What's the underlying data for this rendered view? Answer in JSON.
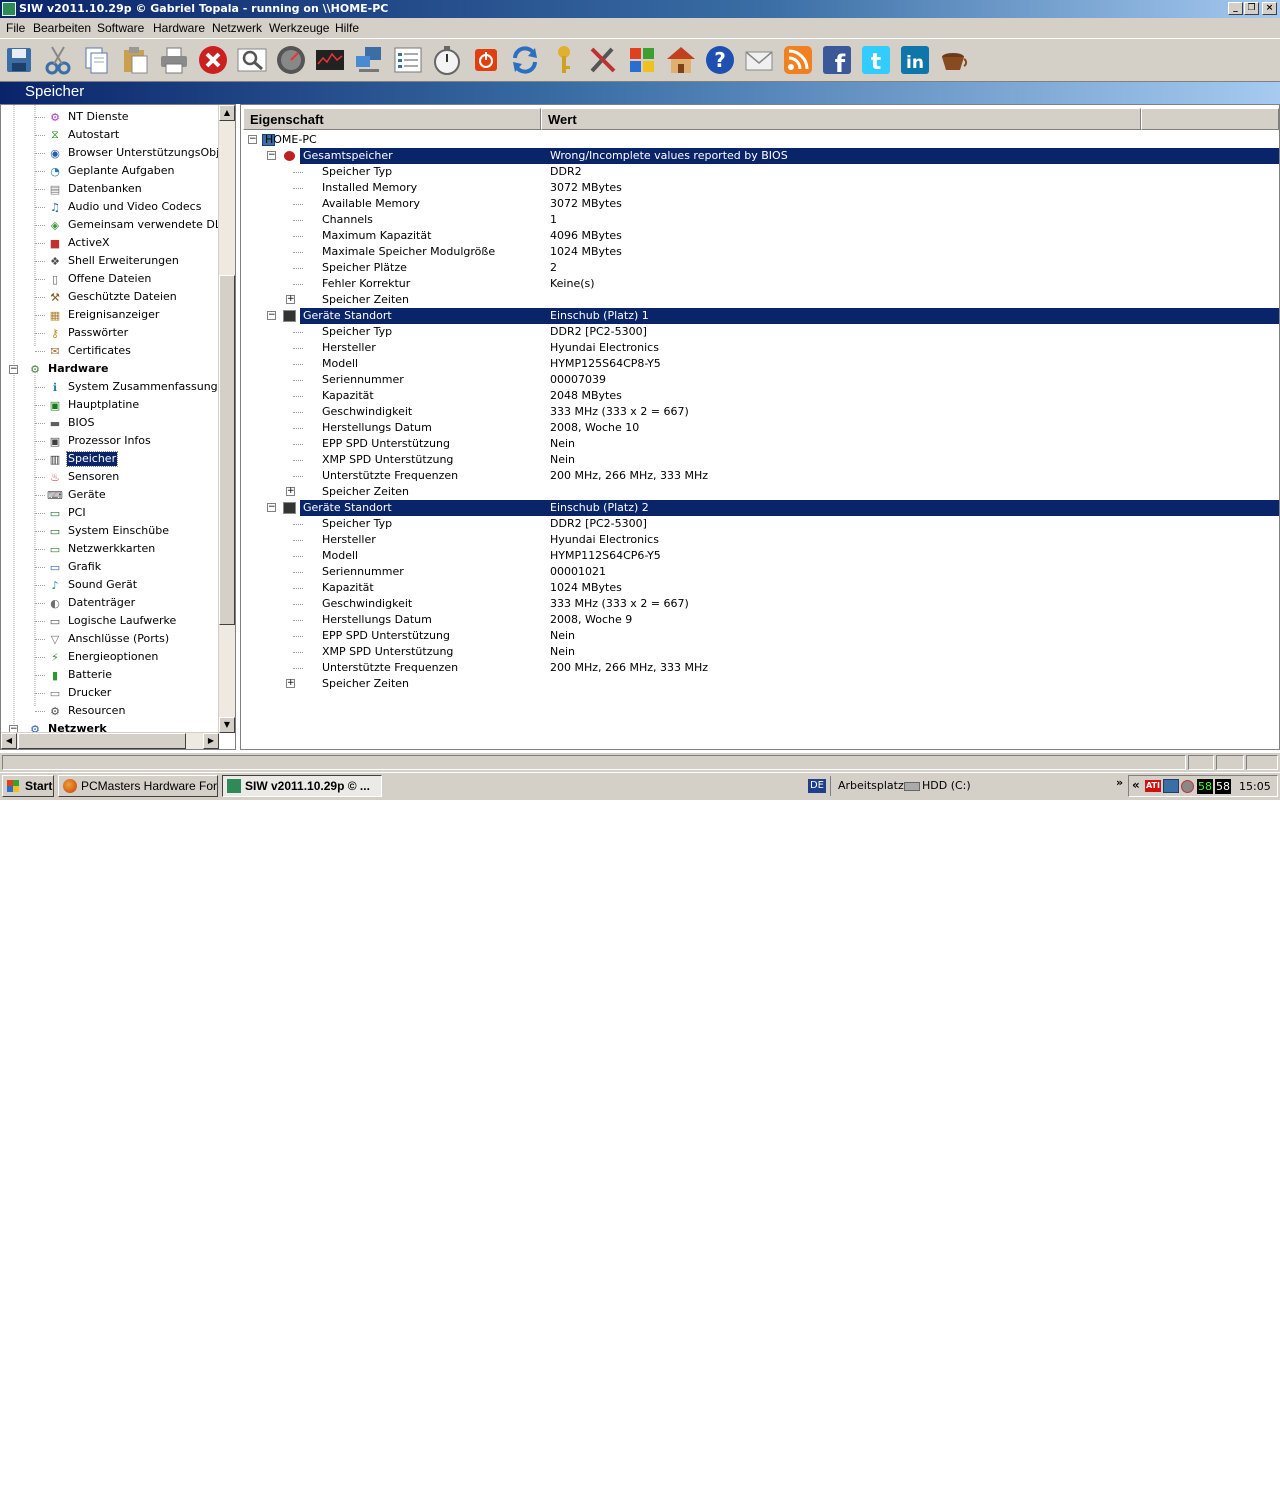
{
  "window": {
    "title": "SIW v2011.10.29p  © Gabriel Topala - running on \\\\HOME-PC",
    "min": "_",
    "max": "❐",
    "close": "×"
  },
  "menu": [
    "File",
    "Bearbeiten",
    "Software",
    "Hardware",
    "Netzwerk",
    "Werkzeuge",
    "Hilfe"
  ],
  "toolbar_icons": [
    "save-icon",
    "cut-icon",
    "copy-icon",
    "paste-icon",
    "print-icon",
    "stop-icon",
    "search-icon",
    "speed-gauge-icon",
    "monitor-icon",
    "network-computer-icon",
    "list-icon",
    "stopwatch-icon",
    "shutdown-icon",
    "refresh-icon",
    "key-icon",
    "tools-icon",
    "windows-icon",
    "home-icon",
    "help-icon",
    "mail-icon",
    "rss-icon",
    "facebook-icon",
    "twitter-icon",
    "linkedin-icon",
    "coffee-icon"
  ],
  "section_title": "Speicher",
  "tree": [
    {
      "label": "NT Dienste",
      "icon": "services-icon",
      "glyph": "⚙",
      "color": "#a040c0"
    },
    {
      "label": "Autostart",
      "icon": "autostart-icon",
      "glyph": "⧖",
      "color": "#1e8c1e"
    },
    {
      "label": "Browser UnterstützungsObjekte",
      "icon": "browser-icon",
      "glyph": "◉",
      "color": "#2a5fb0"
    },
    {
      "label": "Geplante Aufgaben",
      "icon": "tasks-icon",
      "glyph": "◔",
      "color": "#2a7bb0"
    },
    {
      "label": "Datenbanken",
      "icon": "database-icon",
      "glyph": "▤",
      "color": "#7a7a7a"
    },
    {
      "label": "Audio und Video Codecs",
      "icon": "codec-icon",
      "glyph": "♫",
      "color": "#2a5fb0"
    },
    {
      "label": "Gemeinsam verwendete DLLs",
      "icon": "dll-icon",
      "glyph": "◈",
      "color": "#3a9a3a"
    },
    {
      "label": "ActiveX",
      "icon": "activex-icon",
      "glyph": "■",
      "color": "#c03030"
    },
    {
      "label": "Shell Erweiterungen",
      "icon": "shell-icon",
      "glyph": "❖",
      "color": "#505050"
    },
    {
      "label": "Offene Dateien",
      "icon": "open-files-icon",
      "glyph": "▯",
      "color": "#606060"
    },
    {
      "label": "Geschützte Dateien",
      "icon": "protected-files-icon",
      "glyph": "⚒",
      "color": "#806020"
    },
    {
      "label": "Ereignisanzeiger",
      "icon": "event-viewer-icon",
      "glyph": "▦",
      "color": "#b08030"
    },
    {
      "label": "Passwörter",
      "icon": "key-icon",
      "glyph": "⚷",
      "color": "#c09020"
    },
    {
      "label": "Certificates",
      "icon": "certificate-icon",
      "glyph": "✉",
      "color": "#a07040"
    },
    {
      "label": "Hardware",
      "icon": "hardware-icon",
      "glyph": "⚙",
      "color": "#408040",
      "group": true
    },
    {
      "label": "System Zusammenfassung",
      "icon": "summary-icon",
      "glyph": "ℹ",
      "color": "#2a7bb0"
    },
    {
      "label": "Hauptplatine",
      "icon": "motherboard-icon",
      "glyph": "▣",
      "color": "#1a7a1a"
    },
    {
      "label": "BIOS",
      "icon": "bios-chip-icon",
      "glyph": "▬",
      "color": "#606060"
    },
    {
      "label": "Prozessor Infos",
      "icon": "cpu-icon",
      "glyph": "▣",
      "color": "#404040"
    },
    {
      "label": "Speicher",
      "icon": "memory-icon",
      "glyph": "▥",
      "color": "#303030",
      "selected": true
    },
    {
      "label": "Sensoren",
      "icon": "sensor-icon",
      "glyph": "♨",
      "color": "#c03030"
    },
    {
      "label": "Geräte",
      "icon": "devices-icon",
      "glyph": "⌨",
      "color": "#505050"
    },
    {
      "label": "PCI",
      "icon": "pci-icon",
      "glyph": "▭",
      "color": "#1a7a3a"
    },
    {
      "label": "System Einschübe",
      "icon": "slots-icon",
      "glyph": "▭",
      "color": "#2a6a2a"
    },
    {
      "label": "Netzwerkkarten",
      "icon": "network-card-icon",
      "glyph": "▭",
      "color": "#3a7a3a"
    },
    {
      "label": "Grafik",
      "icon": "display-icon",
      "glyph": "▭",
      "color": "#2a5fb0"
    },
    {
      "label": "Sound Gerät",
      "icon": "sound-icon",
      "glyph": "♪",
      "color": "#2a7bb0"
    },
    {
      "label": "Datenträger",
      "icon": "disk-icon",
      "glyph": "◐",
      "color": "#707070"
    },
    {
      "label": "Logische Laufwerke",
      "icon": "drive-icon",
      "glyph": "▭",
      "color": "#505050"
    },
    {
      "label": "Anschlüsse (Ports)",
      "icon": "ports-icon",
      "glyph": "▽",
      "color": "#707070"
    },
    {
      "label": "Energieoptionen",
      "icon": "power-icon",
      "glyph": "⚡",
      "color": "#3a8a3a"
    },
    {
      "label": "Batterie",
      "icon": "battery-icon",
      "glyph": "▮",
      "color": "#2a9a2a"
    },
    {
      "label": "Drucker",
      "icon": "printer-icon",
      "glyph": "▭",
      "color": "#707070"
    },
    {
      "label": "Resourcen",
      "icon": "resources-icon",
      "glyph": "⚙",
      "color": "#505050"
    },
    {
      "label": "Netzwerk",
      "icon": "network-icon",
      "glyph": "⚙",
      "color": "#2a5fb0",
      "group": true
    }
  ],
  "columns": {
    "prop": "Eigenschaft",
    "value": "Wert"
  },
  "rows": [
    {
      "level": 0,
      "prop": "HOME-PC",
      "val": "",
      "exp": "−",
      "icon": "computer-icon"
    },
    {
      "level": 1,
      "prop": "Gesamtspeicher",
      "val": "Wrong/Incomplete values reported by BIOS",
      "exp": "−",
      "icon": "error-icon",
      "hl": true
    },
    {
      "level": 2,
      "prop": "Speicher Typ",
      "val": "DDR2"
    },
    {
      "level": 2,
      "prop": "Installed Memory",
      "val": "3072 MBytes"
    },
    {
      "level": 2,
      "prop": "Available Memory",
      "val": "3072 MBytes"
    },
    {
      "level": 2,
      "prop": "Channels",
      "val": "1"
    },
    {
      "level": 2,
      "prop": "Maximum Kapazität",
      "val": "4096 MBytes"
    },
    {
      "level": 2,
      "prop": "Maximale Speicher Modulgröße",
      "val": "1024 MBytes"
    },
    {
      "level": 2,
      "prop": "Speicher Plätze",
      "val": "2"
    },
    {
      "level": 2,
      "prop": "Fehler Korrektur",
      "val": "Keine(s)"
    },
    {
      "level": 2,
      "prop": "Speicher Zeiten",
      "val": "",
      "exp": "+"
    },
    {
      "level": 1,
      "prop": "Geräte Standort",
      "val": "Einschub (Platz) 1",
      "exp": "−",
      "icon": "memory-module-icon",
      "hl": true
    },
    {
      "level": 2,
      "prop": "Speicher Typ",
      "val": "DDR2 [PC2-5300]"
    },
    {
      "level": 2,
      "prop": "Hersteller",
      "val": "Hyundai Electronics"
    },
    {
      "level": 2,
      "prop": "Modell",
      "val": "HYMP125S64CP8-Y5"
    },
    {
      "level": 2,
      "prop": "Seriennummer",
      "val": "00007039"
    },
    {
      "level": 2,
      "prop": "Kapazität",
      "val": "2048 MBytes"
    },
    {
      "level": 2,
      "prop": "Geschwindigkeit",
      "val": "333 MHz (333 x 2 = 667)"
    },
    {
      "level": 2,
      "prop": "Herstellungs Datum",
      "val": "2008, Woche 10"
    },
    {
      "level": 2,
      "prop": "EPP SPD Unterstützung",
      "val": "Nein"
    },
    {
      "level": 2,
      "prop": "XMP SPD Unterstützung",
      "val": "Nein"
    },
    {
      "level": 2,
      "prop": "Unterstützte Frequenzen",
      "val": "200 MHz, 266 MHz, 333 MHz"
    },
    {
      "level": 2,
      "prop": "Speicher Zeiten",
      "val": "",
      "exp": "+"
    },
    {
      "level": 1,
      "prop": "Geräte Standort",
      "val": "Einschub (Platz) 2",
      "exp": "−",
      "icon": "memory-module-icon",
      "hl": true
    },
    {
      "level": 2,
      "prop": "Speicher Typ",
      "val": "DDR2 [PC2-5300]"
    },
    {
      "level": 2,
      "prop": "Hersteller",
      "val": "Hyundai Electronics"
    },
    {
      "level": 2,
      "prop": "Modell",
      "val": "HYMP112S64CP6-Y5"
    },
    {
      "level": 2,
      "prop": "Seriennummer",
      "val": "00001021"
    },
    {
      "level": 2,
      "prop": "Kapazität",
      "val": "1024 MBytes"
    },
    {
      "level": 2,
      "prop": "Geschwindigkeit",
      "val": "333 MHz (333 x 2 = 667)"
    },
    {
      "level": 2,
      "prop": "Herstellungs Datum",
      "val": "2008, Woche 9"
    },
    {
      "level": 2,
      "prop": "EPP SPD Unterstützung",
      "val": "Nein"
    },
    {
      "level": 2,
      "prop": "XMP SPD Unterstützung",
      "val": "Nein"
    },
    {
      "level": 2,
      "prop": "Unterstützte Frequenzen",
      "val": "200 MHz, 266 MHz, 333 MHz"
    },
    {
      "level": 2,
      "prop": "Speicher Zeiten",
      "val": "",
      "exp": "+"
    }
  ],
  "taskbar": {
    "start": "Start",
    "task1": "PCMasters Hardware For...",
    "task2": "SIW v2011.10.29p  © ...",
    "lang": "DE",
    "location": "Arbeitsplatz",
    "drive": "HDD  (C:)",
    "chevron": "»",
    "tray_expand": "«",
    "temp1": "58",
    "temp2": "58",
    "clock": "15:05"
  }
}
